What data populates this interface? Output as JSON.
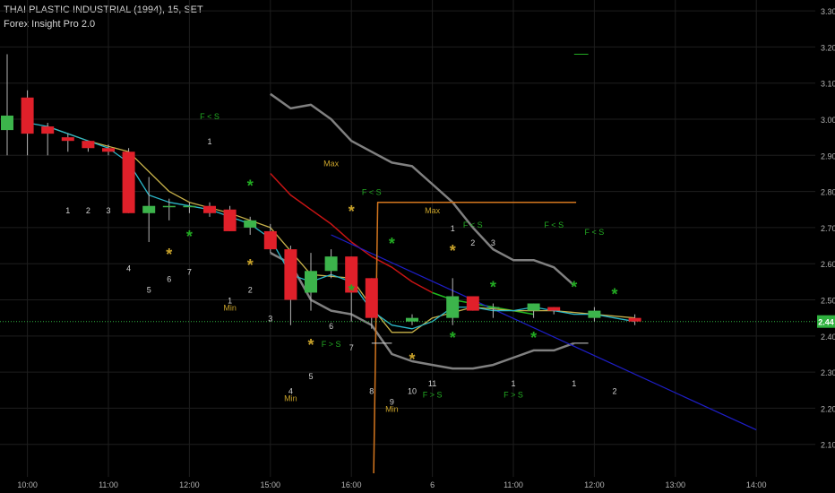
{
  "header": {
    "title": "THAI PLASTIC INDUSTRIAL (1994), 15, SET",
    "indicator": "Forex Insight Pro 2.0"
  },
  "colors": {
    "background": "#000000",
    "grid": "#1e1e1e",
    "axis_text": "#b4b4b4",
    "up_candle": "#3cb44b",
    "down_candle": "#e0202a",
    "ma_fast": "#2bb7c9",
    "ma_slow": "#c8b24a",
    "band": "#808080",
    "red_line": "#c81414",
    "green_line": "#1fb81f",
    "trend": "#1e1ec8",
    "orange": "#d4761e",
    "text_green": "#22aa22",
    "text_gold": "#c8a22a",
    "text_white": "#d2d2d2",
    "price_badge": "#2fb13f"
  },
  "chart_data": {
    "type": "candlestick",
    "x_ticks": [
      "10:00",
      "11:00",
      "12:00",
      "15:00",
      "16:00",
      "6",
      "11:00",
      "12:00",
      "13:00",
      "14:00"
    ],
    "y_ticks": [
      "3.30",
      "3.20",
      "3.10",
      "3.00",
      "2.90",
      "2.80",
      "2.70",
      "2.60",
      "2.50",
      "2.40",
      "2.30",
      "2.20",
      "2.10"
    ],
    "last_price": "2.44",
    "ylim": [
      2.01,
      3.33
    ],
    "candles": [
      {
        "i": 0,
        "o": 2.97,
        "h": 3.18,
        "l": 2.9,
        "c": 3.01
      },
      {
        "i": 1,
        "o": 3.06,
        "h": 3.08,
        "l": 2.9,
        "c": 2.96
      },
      {
        "i": 2,
        "o": 2.98,
        "h": 2.99,
        "l": 2.9,
        "c": 2.96
      },
      {
        "i": 3,
        "o": 2.95,
        "h": 2.96,
        "l": 2.91,
        "c": 2.94
      },
      {
        "i": 4,
        "o": 2.94,
        "h": 2.94,
        "l": 2.91,
        "c": 2.92
      },
      {
        "i": 5,
        "o": 2.92,
        "h": 2.93,
        "l": 2.9,
        "c": 2.91
      },
      {
        "i": 6,
        "o": 2.91,
        "h": 2.92,
        "l": 2.74,
        "c": 2.74
      },
      {
        "i": 7,
        "o": 2.74,
        "h": 2.84,
        "l": 2.66,
        "c": 2.76
      },
      {
        "i": 8,
        "o": 2.76,
        "h": 2.78,
        "l": 2.72,
        "c": 2.76
      },
      {
        "i": 9,
        "o": 2.76,
        "h": 2.77,
        "l": 2.74,
        "c": 2.76
      },
      {
        "i": 10,
        "o": 2.76,
        "h": 2.77,
        "l": 2.73,
        "c": 2.74
      },
      {
        "i": 11,
        "o": 2.75,
        "h": 2.76,
        "l": 2.69,
        "c": 2.69
      },
      {
        "i": 12,
        "o": 2.7,
        "h": 2.73,
        "l": 2.68,
        "c": 2.72
      },
      {
        "i": 13,
        "o": 2.69,
        "h": 2.71,
        "l": 2.63,
        "c": 2.64
      },
      {
        "i": 14,
        "o": 2.64,
        "h": 2.65,
        "l": 2.43,
        "c": 2.5
      },
      {
        "i": 15,
        "o": 2.52,
        "h": 2.63,
        "l": 2.47,
        "c": 2.58
      },
      {
        "i": 16,
        "o": 2.58,
        "h": 2.64,
        "l": 2.56,
        "c": 2.62
      },
      {
        "i": 17,
        "o": 2.62,
        "h": 2.62,
        "l": 2.44,
        "c": 2.52
      },
      {
        "i": 18,
        "o": 2.56,
        "h": 2.56,
        "l": 2.42,
        "c": 2.45
      },
      {
        "i": 20,
        "o": 2.44,
        "h": 2.46,
        "l": 2.43,
        "c": 2.45
      },
      {
        "i": 22,
        "o": 2.45,
        "h": 2.56,
        "l": 2.43,
        "c": 2.51
      },
      {
        "i": 23,
        "o": 2.51,
        "h": 2.51,
        "l": 2.47,
        "c": 2.47
      },
      {
        "i": 24,
        "o": 2.48,
        "h": 2.49,
        "l": 2.45,
        "c": 2.48
      },
      {
        "i": 26,
        "o": 2.47,
        "h": 2.49,
        "l": 2.45,
        "c": 2.49
      },
      {
        "i": 27,
        "o": 2.48,
        "h": 2.48,
        "l": 2.46,
        "c": 2.47
      },
      {
        "i": 29,
        "o": 2.45,
        "h": 2.48,
        "l": 2.44,
        "c": 2.47
      },
      {
        "i": 31,
        "o": 2.45,
        "h": 2.46,
        "l": 2.43,
        "c": 2.44
      }
    ],
    "ma_fast": [
      [
        1,
        2.99
      ],
      [
        2,
        2.98
      ],
      [
        3,
        2.96
      ],
      [
        4,
        2.94
      ],
      [
        5,
        2.92
      ],
      [
        6,
        2.88
      ],
      [
        7,
        2.79
      ],
      [
        8,
        2.77
      ],
      [
        9,
        2.76
      ],
      [
        10,
        2.75
      ],
      [
        11,
        2.73
      ],
      [
        12,
        2.71
      ],
      [
        13,
        2.67
      ],
      [
        14,
        2.57
      ],
      [
        15,
        2.55
      ],
      [
        16,
        2.57
      ],
      [
        17,
        2.55
      ],
      [
        18,
        2.47
      ],
      [
        19,
        2.43
      ],
      [
        20,
        2.42
      ],
      [
        21,
        2.44
      ],
      [
        22,
        2.48
      ],
      [
        23,
        2.48
      ],
      [
        24,
        2.47
      ],
      [
        25,
        2.47
      ],
      [
        26,
        2.48
      ],
      [
        27,
        2.47
      ],
      [
        28,
        2.46
      ],
      [
        29,
        2.46
      ],
      [
        30,
        2.45
      ],
      [
        31,
        2.44
      ]
    ],
    "ma_slow": [
      [
        2,
        2.98
      ],
      [
        4,
        2.94
      ],
      [
        6,
        2.91
      ],
      [
        8,
        2.8
      ],
      [
        9,
        2.77
      ],
      [
        11,
        2.74
      ],
      [
        13,
        2.7
      ],
      [
        15,
        2.57
      ],
      [
        17,
        2.56
      ],
      [
        18,
        2.48
      ],
      [
        19,
        2.41
      ],
      [
        20,
        2.41
      ],
      [
        21,
        2.45
      ],
      [
        23,
        2.48
      ],
      [
        25,
        2.47
      ],
      [
        27,
        2.47
      ],
      [
        29,
        2.46
      ],
      [
        31,
        2.45
      ]
    ],
    "band_upper": [
      [
        13,
        3.07
      ],
      [
        14,
        3.03
      ],
      [
        15,
        3.04
      ],
      [
        16,
        3.0
      ],
      [
        17,
        2.94
      ],
      [
        18,
        2.91
      ],
      [
        19,
        2.88
      ],
      [
        20,
        2.87
      ],
      [
        21,
        2.82
      ],
      [
        22,
        2.77
      ],
      [
        23,
        2.7
      ],
      [
        24,
        2.64
      ],
      [
        25,
        2.61
      ],
      [
        26,
        2.61
      ],
      [
        27,
        2.59
      ],
      [
        28,
        2.54
      ]
    ],
    "band_lower": [
      [
        13,
        2.63
      ],
      [
        14,
        2.6
      ],
      [
        15,
        2.5
      ],
      [
        16,
        2.47
      ],
      [
        17,
        2.46
      ],
      [
        18,
        2.43
      ],
      [
        19,
        2.35
      ],
      [
        20,
        2.33
      ],
      [
        21,
        2.32
      ],
      [
        22,
        2.31
      ],
      [
        23,
        2.31
      ],
      [
        24,
        2.32
      ],
      [
        25,
        2.34
      ],
      [
        26,
        2.36
      ],
      [
        27,
        2.36
      ],
      [
        28,
        2.38
      ]
    ],
    "red_line": [
      [
        13,
        2.85
      ],
      [
        14,
        2.79
      ],
      [
        15,
        2.75
      ],
      [
        16,
        2.71
      ],
      [
        17,
        2.66
      ],
      [
        18,
        2.62
      ],
      [
        19,
        2.59
      ],
      [
        20,
        2.55
      ],
      [
        21,
        2.52
      ]
    ],
    "green_line": [
      [
        21,
        2.52
      ],
      [
        22,
        2.5
      ],
      [
        23,
        2.49
      ],
      [
        24,
        2.48
      ],
      [
        25,
        2.47
      ],
      [
        26,
        2.46
      ]
    ],
    "trend_line": [
      [
        16,
        2.68
      ],
      [
        37,
        2.14
      ]
    ],
    "orange_step": [
      [
        18.1,
        2.02
      ],
      [
        18.3,
        2.77
      ],
      [
        28.1,
        2.77
      ]
    ],
    "short_levels": [
      {
        "x0": 18.0,
        "x1": 19.0,
        "y": 2.38,
        "color": "white"
      },
      {
        "x0": 28.0,
        "x1": 28.7,
        "y": 3.18,
        "color": "green"
      },
      {
        "x0": 28.0,
        "x1": 28.7,
        "y": 2.38,
        "color": "white"
      }
    ],
    "annotations": [
      {
        "x": 3,
        "y": 2.74,
        "text": "1",
        "color": "white"
      },
      {
        "x": 4,
        "y": 2.74,
        "text": "2",
        "color": "white"
      },
      {
        "x": 5,
        "y": 2.74,
        "text": "3",
        "color": "white"
      },
      {
        "x": 6,
        "y": 2.58,
        "text": "4",
        "color": "white"
      },
      {
        "x": 7,
        "y": 2.52,
        "text": "5",
        "color": "white"
      },
      {
        "x": 8,
        "y": 2.55,
        "text": "6",
        "color": "white"
      },
      {
        "x": 9,
        "y": 2.57,
        "text": "7",
        "color": "white"
      },
      {
        "x": 10,
        "y": 2.93,
        "text": "1",
        "color": "white"
      },
      {
        "x": 10,
        "y": 3.0,
        "text": "F < S",
        "color": "green"
      },
      {
        "x": 11,
        "y": 2.49,
        "text": "1",
        "color": "white"
      },
      {
        "x": 11,
        "y": 2.47,
        "text": "Min",
        "color": "gold"
      },
      {
        "x": 12,
        "y": 2.52,
        "text": "2",
        "color": "white"
      },
      {
        "x": 13,
        "y": 2.44,
        "text": "3",
        "color": "white"
      },
      {
        "x": 14,
        "y": 2.24,
        "text": "4",
        "color": "white"
      },
      {
        "x": 14,
        "y": 2.22,
        "text": "Min",
        "color": "gold"
      },
      {
        "x": 15,
        "y": 2.28,
        "text": "5",
        "color": "white"
      },
      {
        "x": 16,
        "y": 2.42,
        "text": "6",
        "color": "white"
      },
      {
        "x": 16,
        "y": 2.37,
        "text": "F > S",
        "color": "green"
      },
      {
        "x": 17,
        "y": 2.36,
        "text": "7",
        "color": "white"
      },
      {
        "x": 16,
        "y": 2.87,
        "text": "Max",
        "color": "gold"
      },
      {
        "x": 18,
        "y": 2.79,
        "text": "F < S",
        "color": "green"
      },
      {
        "x": 18,
        "y": 2.24,
        "text": "8",
        "color": "white"
      },
      {
        "x": 19,
        "y": 2.21,
        "text": "9",
        "color": "white"
      },
      {
        "x": 19,
        "y": 2.19,
        "text": "Min",
        "color": "gold"
      },
      {
        "x": 20,
        "y": 2.24,
        "text": "10",
        "color": "white"
      },
      {
        "x": 21,
        "y": 2.26,
        "text": "11",
        "color": "white"
      },
      {
        "x": 21,
        "y": 2.23,
        "text": "F > S",
        "color": "green"
      },
      {
        "x": 21,
        "y": 2.74,
        "text": "Max",
        "color": "gold"
      },
      {
        "x": 22,
        "y": 2.69,
        "text": "1",
        "color": "white"
      },
      {
        "x": 23,
        "y": 2.7,
        "text": "F < S",
        "color": "green"
      },
      {
        "x": 23,
        "y": 2.65,
        "text": "2",
        "color": "white"
      },
      {
        "x": 24,
        "y": 2.65,
        "text": "3",
        "color": "white"
      },
      {
        "x": 25,
        "y": 2.26,
        "text": "1",
        "color": "white"
      },
      {
        "x": 25,
        "y": 2.23,
        "text": "F > S",
        "color": "green"
      },
      {
        "x": 27,
        "y": 2.7,
        "text": "F < S",
        "color": "green"
      },
      {
        "x": 28,
        "y": 2.26,
        "text": "1",
        "color": "white"
      },
      {
        "x": 29,
        "y": 2.68,
        "text": "F < S",
        "color": "green"
      },
      {
        "x": 30,
        "y": 2.24,
        "text": "2",
        "color": "white"
      }
    ],
    "stars": [
      {
        "x": 8,
        "y": 2.63,
        "color": "gold"
      },
      {
        "x": 9,
        "y": 2.68,
        "color": "green"
      },
      {
        "x": 12,
        "y": 2.82,
        "color": "green"
      },
      {
        "x": 12,
        "y": 2.6,
        "color": "gold"
      },
      {
        "x": 15,
        "y": 2.38,
        "color": "gold"
      },
      {
        "x": 17,
        "y": 2.75,
        "color": "gold"
      },
      {
        "x": 17,
        "y": 2.53,
        "color": "green"
      },
      {
        "x": 19,
        "y": 2.66,
        "color": "green"
      },
      {
        "x": 20,
        "y": 2.34,
        "color": "gold"
      },
      {
        "x": 22,
        "y": 2.64,
        "color": "gold"
      },
      {
        "x": 22,
        "y": 2.4,
        "color": "green"
      },
      {
        "x": 24,
        "y": 2.54,
        "color": "green"
      },
      {
        "x": 26,
        "y": 2.4,
        "color": "green"
      },
      {
        "x": 28,
        "y": 2.54,
        "color": "green"
      },
      {
        "x": 30,
        "y": 2.52,
        "color": "green"
      }
    ]
  }
}
